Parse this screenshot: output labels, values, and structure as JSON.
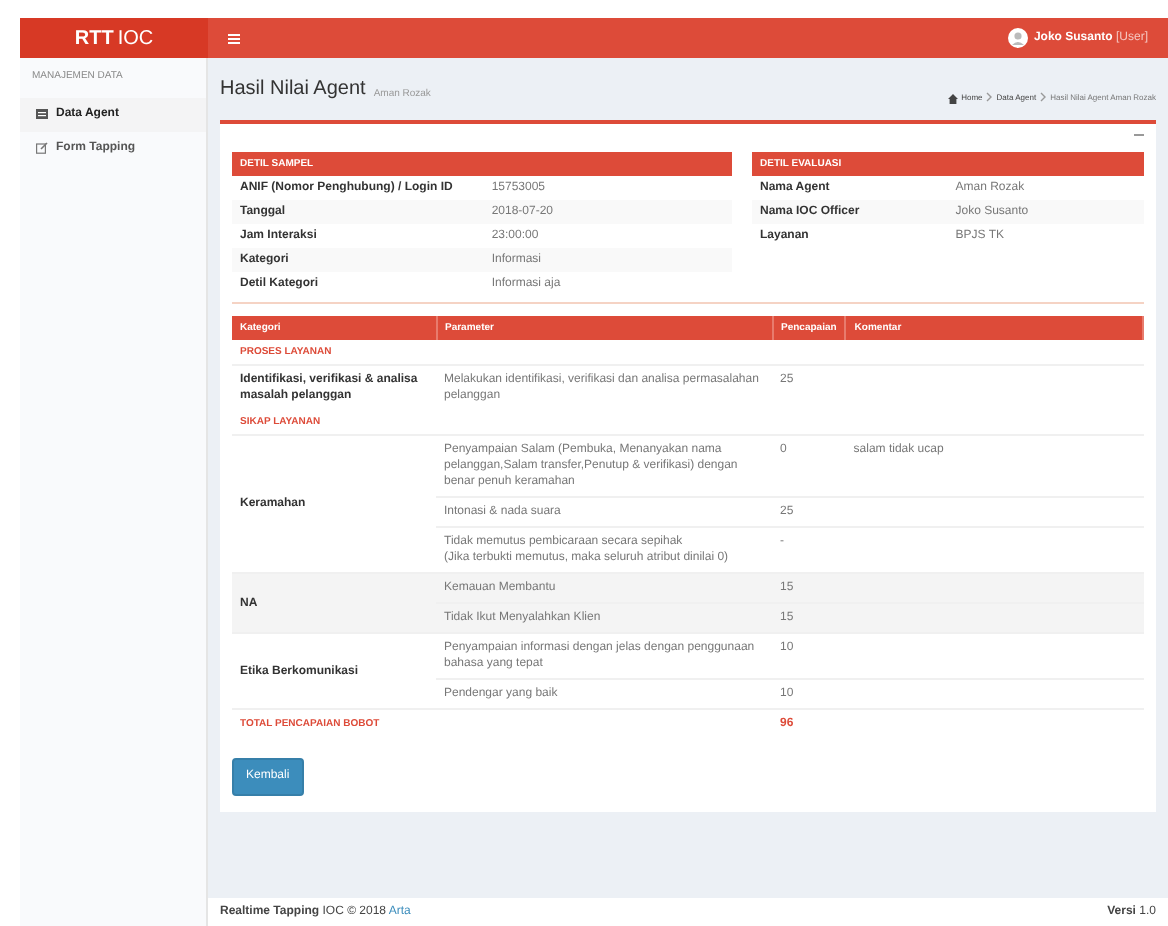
{
  "header": {
    "logo_bold": "RTT",
    "logo_rest": "IOC",
    "user": {
      "name": "Joko Susanto",
      "role": "[User]"
    }
  },
  "sidebar": {
    "heading": "MANAJEMEN DATA",
    "items": [
      {
        "label": "Data Agent",
        "kind": "list",
        "selected": true
      },
      {
        "label": "Form Tapping",
        "kind": "form",
        "selected": false
      }
    ]
  },
  "page": {
    "title": "Hasil Nilai Agent",
    "subtitle": "Aman Rozak",
    "breadcrumb": [
      "Home",
      "Data Agent",
      "Hasil Nilai Agent Aman Rozak"
    ]
  },
  "detail_sampel": {
    "title": "DETIL SAMPEL",
    "rows": [
      {
        "label": "ANIF (Nomor Penghubung) / Login ID",
        "value": "15753005"
      },
      {
        "label": "Tanggal",
        "value": "2018-07-20"
      },
      {
        "label": "Jam Interaksi",
        "value": "23:00:00"
      },
      {
        "label": "Kategori",
        "value": "Informasi"
      },
      {
        "label": "Detil Kategori",
        "value": "Informasi aja"
      }
    ]
  },
  "detail_evaluasi": {
    "title": "DETIL EVALUASI",
    "rows": [
      {
        "label": "Nama Agent",
        "value": "Aman Rozak"
      },
      {
        "label": "Nama IOC Officer",
        "value": "Joko Susanto"
      },
      {
        "label": "Layanan",
        "value": "BPJS TK"
      }
    ]
  },
  "table": {
    "columns": [
      "Kategori",
      "Parameter",
      "Pencapaian",
      "Komentar"
    ],
    "sections": [
      {
        "title": "PROSES LAYANAN",
        "groups": [
          {
            "kategori": "Identifikasi, verifikasi & analisa masalah pelanggan",
            "items": [
              {
                "parameter": "Melakukan identifikasi, verifikasi dan analisa permasalahan pelanggan",
                "pencapaian": "25"
              }
            ]
          }
        ]
      },
      {
        "title": "SIKAP LAYANAN",
        "groups": [
          {
            "kategori": "Keramahan",
            "items": [
              {
                "parameter": "Penyampaian Salam (Pembuka, Menanyakan nama pelanggan,Salam transfer,Penutup & verifikasi) dengan benar penuh keramahan",
                "pencapaian": "0",
                "komentar": "salam tidak ucap"
              },
              {
                "parameter": "Intonasi & nada suara",
                "pencapaian": "25"
              },
              {
                "parameter": "Tidak memutus pembicaraan secara sepihak\n(Jika terbukti memutus, maka seluruh atribut dinilai 0)",
                "pencapaian": "-"
              }
            ]
          },
          {
            "kategori": "NA",
            "items": [
              {
                "parameter": "Kemauan Membantu",
                "pencapaian": "15"
              },
              {
                "parameter": "Tidak Ikut Menyalahkan Klien",
                "pencapaian": "15"
              }
            ]
          },
          {
            "kategori": "Etika Berkomunikasi",
            "items": [
              {
                "parameter": "Penyampaian informasi dengan jelas dengan penggunaan bahasa yang tepat",
                "pencapaian": "10"
              },
              {
                "parameter": "Pendengar yang baik",
                "pencapaian": "10"
              }
            ]
          }
        ]
      }
    ],
    "total": {
      "label": "TOTAL PENCAPAIAN BOBOT",
      "value": "96"
    }
  },
  "button": "Kembali",
  "footer": {
    "left_bold": "Realtime Tapping",
    "left_text": "IOC © 2018",
    "link": "Arta",
    "right_bold": "Versi",
    "right_text": "1.0"
  }
}
